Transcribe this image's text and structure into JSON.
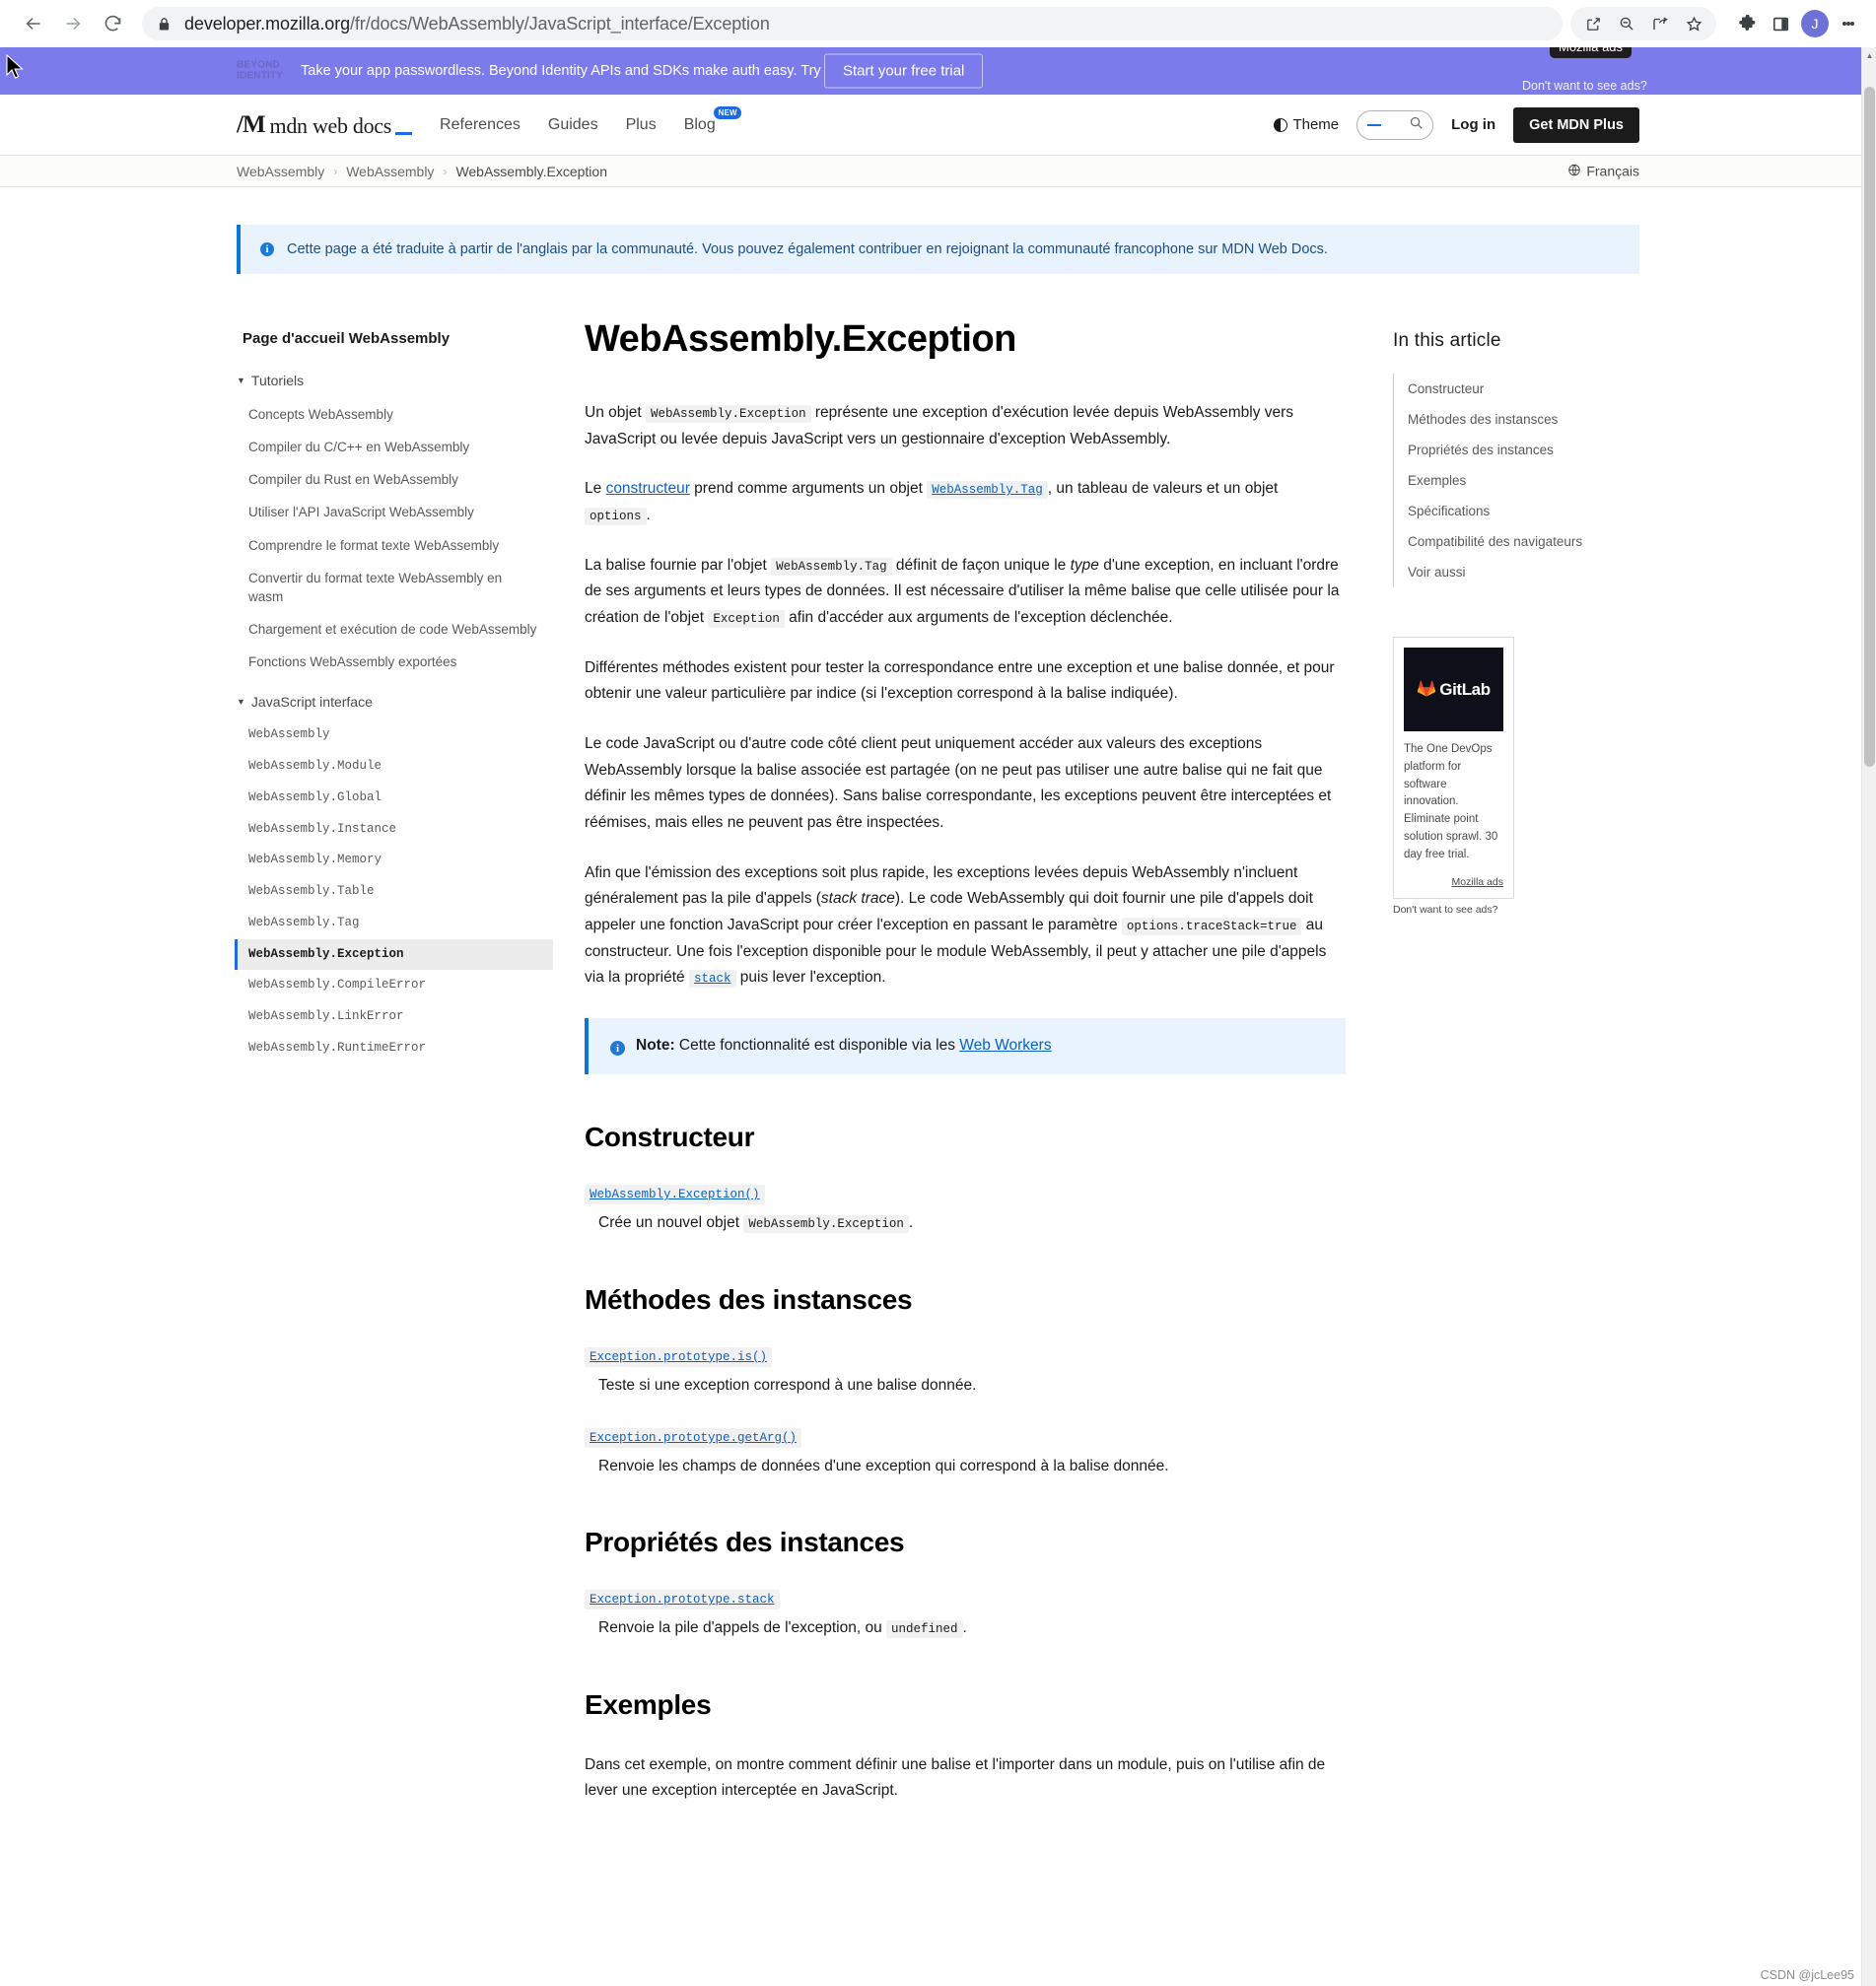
{
  "browser": {
    "url_bold": "developer.mozilla.org",
    "url_dim": "/fr/docs/WebAssembly/JavaScript_interface/Exception",
    "back_icon": "back-arrow-icon",
    "forward_icon": "forward-arrow-icon",
    "reload_icon": "reload-icon",
    "lock_icon": "lock-icon",
    "toolbar_icons": [
      "share-external-icon",
      "zoom-out-icon",
      "share-icon",
      "bookmark-star-icon"
    ],
    "extensions_icon": "puzzle-piece-icon",
    "sidepanel_icon": "side-panel-icon",
    "avatar_letter": "J",
    "menu_icon": "kebab-menu-icon"
  },
  "ad_banner": {
    "logo_line1": "BEYOND",
    "logo_line2": "IDENTITY",
    "text": "Take your app passwordless. Beyond Identity APIs and SDKs make auth easy. Try for free!",
    "cta": "Start your free trial",
    "tooltip": "Mozilla ads",
    "no_ads": "Don't want to see ads?",
    "background": "#7c7bec"
  },
  "header": {
    "logo_glyph": "/M",
    "logo_word": "mdn web docs",
    "nav": [
      {
        "label": "References",
        "badge": ""
      },
      {
        "label": "Guides",
        "badge": ""
      },
      {
        "label": "Plus",
        "badge": ""
      },
      {
        "label": "Blog",
        "badge": "NEW"
      }
    ],
    "theme_label": "Theme",
    "search_placeholder": "",
    "search_icon": "search-icon",
    "login_label": "Log in",
    "mdn_plus_label": "Get MDN Plus"
  },
  "breadcrumb": {
    "items": [
      "WebAssembly",
      "WebAssembly",
      "WebAssembly.Exception"
    ],
    "separator": "›",
    "language": "Français",
    "globe_icon": "globe-icon"
  },
  "locale_notice": {
    "text": "Cette page a été traduite à partir de l'anglais par la communauté. Vous pouvez également contribuer en rejoignant la communauté francophone sur MDN Web Docs.",
    "icon": "info-circle-icon"
  },
  "sidebar": {
    "home": "Page d'accueil WebAssembly",
    "groups": [
      {
        "label": "Tutoriels",
        "mono": false,
        "items": [
          "Concepts WebAssembly",
          "Compiler du C/C++ en WebAssembly",
          "Compiler du Rust en WebAssembly",
          "Utiliser l'API JavaScript WebAssembly",
          "Comprendre le format texte WebAssembly",
          "Convertir du format texte WebAssembly en wasm",
          "Chargement et exécution de code WebAssembly",
          "Fonctions WebAssembly exportées"
        ]
      },
      {
        "label": "JavaScript interface",
        "mono": true,
        "items": [
          "WebAssembly",
          "WebAssembly.Module",
          "WebAssembly.Global",
          "WebAssembly.Instance",
          "WebAssembly.Memory",
          "WebAssembly.Table",
          "WebAssembly.Tag",
          "WebAssembly.Exception",
          "WebAssembly.CompileError",
          "WebAssembly.LinkError",
          "WebAssembly.RuntimeError"
        ],
        "current": "WebAssembly.Exception"
      }
    ]
  },
  "article": {
    "title": "WebAssembly.Exception",
    "p1_a": "Un objet ",
    "p1_code": "WebAssembly.Exception",
    "p1_b": " représente une exception d'exécution levée depuis WebAssembly vers JavaScript ou levée depuis JavaScript vers un gestionnaire d'exception WebAssembly.",
    "p2_a": "Le ",
    "p2_link": "constructeur",
    "p2_b": " prend comme arguments un objet ",
    "p2_code": "WebAssembly.Tag",
    "p2_c": ", un tableau de valeurs et un objet ",
    "p2_code2": "options",
    "p2_d": ".",
    "p3_a": "La balise fournie par l'objet ",
    "p3_code": "WebAssembly.Tag",
    "p3_b": " définit de façon unique le ",
    "p3_em": "type",
    "p3_c": " d'une exception, en incluant l'ordre de ses arguments et leurs types de données. Il est nécessaire d'utiliser la même balise que celle utilisée pour la création de l'objet ",
    "p3_code2": "Exception",
    "p3_d": " afin d'accéder aux arguments de l'exception déclenchée.",
    "p4": "Différentes méthodes existent pour tester la correspondance entre une exception et une balise donnée, et pour obtenir une valeur particulière par indice (si l'exception correspond à la balise indiquée).",
    "p5": "Le code JavaScript ou d'autre code côté client peut uniquement accéder aux valeurs des exceptions WebAssembly lorsque la balise associée est partagée (on ne peut pas utiliser une autre balise qui ne fait que définir les mêmes types de données). Sans balise correspondante, les exceptions peuvent être interceptées et réémises, mais elles ne peuvent pas être inspectées.",
    "p6_a": "Afin que l'émission des exceptions soit plus rapide, les exceptions levées depuis WebAssembly n'incluent généralement pas la pile d'appels (",
    "p6_em": "stack trace",
    "p6_b": "). Le code WebAssembly qui doit fournir une pile d'appels doit appeler une fonction JavaScript pour créer l'exception en passant le paramètre ",
    "p6_code": "options.traceStack=true",
    "p6_c": " au constructeur. Une fois l'exception disponible pour le module WebAssembly, il peut y attacher une pile d'appels via la propriété ",
    "p6_code2": "stack",
    "p6_d": " puis lever l'exception.",
    "note_label": "Note:",
    "note_text": " Cette fonctionnalité est disponible via les ",
    "note_link": "Web Workers",
    "sections": [
      {
        "heading": "Constructeur",
        "entries": [
          {
            "term": "WebAssembly.Exception()",
            "desc_a": "Crée un nouvel objet ",
            "desc_code": "WebAssembly.Exception",
            "desc_b": "."
          }
        ]
      },
      {
        "heading": "Méthodes des instansces",
        "entries": [
          {
            "term": "Exception.prototype.is()",
            "desc_a": "Teste si une exception correspond à une balise donnée.",
            "desc_code": "",
            "desc_b": ""
          },
          {
            "term": "Exception.prototype.getArg()",
            "desc_a": "Renvoie les champs de données d'une exception qui correspond à la balise donnée.",
            "desc_code": "",
            "desc_b": ""
          }
        ]
      },
      {
        "heading": "Propriétés des instances",
        "entries": [
          {
            "term": "Exception.prototype.stack",
            "desc_a": "Renvoie la pile d'appels de l'exception, ou ",
            "desc_code": "undefined",
            "desc_b": "."
          }
        ]
      }
    ],
    "examples_heading": "Exemples",
    "examples_text": "Dans cet exemple, on montre comment définir une balise et l'importer dans un module, puis on l'utilise afin de lever une exception interceptée en JavaScript."
  },
  "toc": {
    "title": "In this article",
    "items": [
      "Constructeur",
      "Méthodes des instansces",
      "Propriétés des instances",
      "Exemples",
      "Spécifications",
      "Compatibilité des navigateurs",
      "Voir aussi"
    ]
  },
  "side_ad": {
    "brand": "GitLab",
    "logo_icon": "gitlab-tanuki-icon",
    "copy": "The One DevOps platform for software innovation. Eliminate point solution sprawl. 30 day free trial.",
    "mozilla_ads": "Mozilla ads",
    "no_ads": "Don't want to see ads?"
  },
  "watermark": "CSDN @jcLee95"
}
